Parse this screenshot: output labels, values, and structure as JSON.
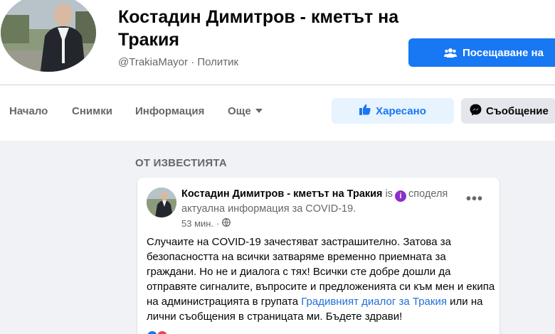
{
  "page": {
    "name": "Костадин Димитров - кметът на Тракия",
    "handle": "@TrakiaMayor",
    "separator": "·",
    "category": "Политик"
  },
  "buttons": {
    "visit": "Посещаване на",
    "like": "Харесано",
    "message": "Съобщение"
  },
  "nav": {
    "home": "Начало",
    "photos": "Снимки",
    "info": "Информация",
    "more": "Още"
  },
  "section": {
    "title": "ОТ ИЗВЕСТИЯТА"
  },
  "post": {
    "author": "Костадин Димитров - кметът на Тракия",
    "is": "is",
    "action": "споделя",
    "action_line2": "актуална информация за COVID-19.",
    "time": "53 мин.",
    "time_sep": "·",
    "body_text": "Случаите на COVID-19 зачестяват застрашително. Затова за безопасността на всички затваряме временно приемната за граждани. Но не и диалога с тях! Всички сте добре дошли да отправяте сигналите, въпросите и предложенията си към мен и екипа на администрацията в групата",
    "body_link": "Градивният диалог за Тракия",
    "body_end": "или на лични съобщения в страницата ми. Бъдете здрави!"
  },
  "icons": {
    "visit": "group-icon",
    "like": "thumbs-up-icon",
    "message": "messenger-icon",
    "more_caret": "caret-down-icon",
    "info": "info-icon",
    "globe": "globe-icon",
    "options": "more-options-icon"
  },
  "colors": {
    "brand_blue": "#1877f2",
    "like_bg": "#e7f3ff",
    "link": "#216fdb",
    "info_purple": "#8b2fc9",
    "page_bg": "#f0f2f5"
  }
}
